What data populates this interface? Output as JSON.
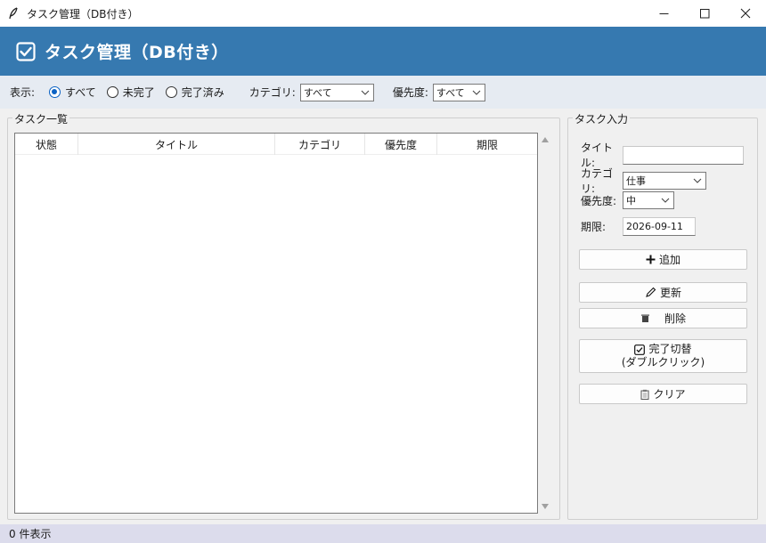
{
  "window": {
    "title": "タスク管理（DB付き）",
    "icon": "feather-icon"
  },
  "header": {
    "title": "タスク管理（DB付き）",
    "icon": "checkbox-icon"
  },
  "filter": {
    "label": "表示:",
    "options": [
      "すべて",
      "未完了",
      "完了済み"
    ],
    "selected_index": 0,
    "category_label": "カテゴリ:",
    "category_value": "すべて",
    "priority_label": "優先度:",
    "priority_value": "すべて"
  },
  "task_list": {
    "legend": "タスク一覧",
    "columns": [
      "状態",
      "タイトル",
      "カテゴリ",
      "優先度",
      "期限"
    ],
    "rows": []
  },
  "task_input": {
    "legend": "タスク入力",
    "title_label": "タイトル:",
    "title_value": "",
    "category_label": "カテゴリ:",
    "category_value": "仕事",
    "priority_label": "優先度:",
    "priority_value": "中",
    "due_label": "期限:",
    "due_value": "2026-09-11"
  },
  "buttons": {
    "add": "追加",
    "update": "更新",
    "delete": "削除",
    "toggle_line1": "完了切替",
    "toggle_line2": "(ダブルクリック)",
    "clear": "クリア"
  },
  "status": {
    "text": "0 件表示"
  },
  "colors": {
    "header_bg": "#3679b0",
    "filter_bg": "#e6ebf2",
    "status_bg": "#dcdcec",
    "radio_accent": "#0b62c4"
  }
}
